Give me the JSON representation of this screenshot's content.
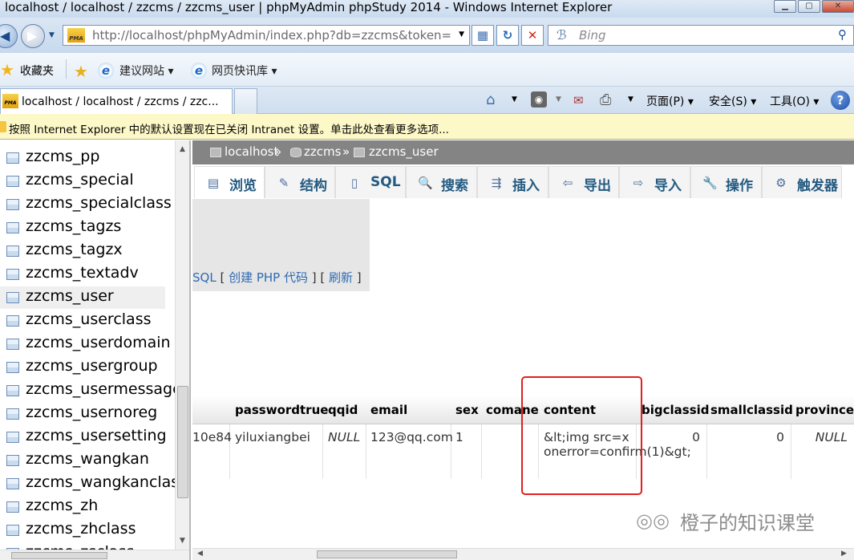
{
  "window": {
    "title": "localhost / localhost / zzcms / zzcms_user | phpMyAdmin phpStudy 2014 - Windows Internet Explorer"
  },
  "address_bar": {
    "url": "http://localhost/phpMyAdmin/index.php?db=zzcms&token=",
    "search_placeholder": "Bing"
  },
  "favorites_bar": {
    "favorites_label": "收藏夹",
    "items": [
      {
        "label": "建议网站 ▾"
      },
      {
        "label": "网页快讯库 ▾"
      }
    ]
  },
  "tabs": [
    {
      "label": "localhost / localhost / zzcms / zzc..."
    }
  ],
  "command_bar": {
    "page_menu": "页面(P) ▾",
    "safety_menu": "安全(S) ▾",
    "tools_menu": "工具(O) ▾"
  },
  "info_bar": {
    "text": "按照 Internet Explorer 中的默认设置现在已关闭 Intranet 设置。单击此处查看更多选项..."
  },
  "left_nav": {
    "tables": [
      {
        "name": "zzcms_pp"
      },
      {
        "name": "zzcms_special"
      },
      {
        "name": "zzcms_specialclass"
      },
      {
        "name": "zzcms_tagzs"
      },
      {
        "name": "zzcms_tagzx"
      },
      {
        "name": "zzcms_textadv"
      },
      {
        "name": "zzcms_user",
        "selected": true
      },
      {
        "name": "zzcms_userclass"
      },
      {
        "name": "zzcms_userdomain"
      },
      {
        "name": "zzcms_usergroup"
      },
      {
        "name": "zzcms_usermessage"
      },
      {
        "name": "zzcms_usernoreg"
      },
      {
        "name": "zzcms_usersetting"
      },
      {
        "name": "zzcms_wangkan"
      },
      {
        "name": "zzcms_wangkanclass"
      },
      {
        "name": "zzcms_zh"
      },
      {
        "name": "zzcms_zhclass"
      },
      {
        "name": "zzcms_zsclass"
      }
    ]
  },
  "breadcrumb": {
    "server": "localhost",
    "sep": "»",
    "database": "zzcms",
    "table": "zzcms_user"
  },
  "pma_tabs": [
    {
      "label": "浏览",
      "icon": "browse-icon",
      "glyph": "▤"
    },
    {
      "label": "结构",
      "icon": "structure-icon",
      "glyph": "✎"
    },
    {
      "label": "SQL",
      "icon": "sql-icon",
      "glyph": "▯"
    },
    {
      "label": "搜索",
      "icon": "search-icon",
      "glyph": "🔍"
    },
    {
      "label": "插入",
      "icon": "insert-icon",
      "glyph": "⇶"
    },
    {
      "label": "导出",
      "icon": "export-icon",
      "glyph": "⇦"
    },
    {
      "label": "导入",
      "icon": "import-icon",
      "glyph": "⇨"
    },
    {
      "label": "操作",
      "icon": "operations-icon",
      "glyph": "🔧"
    },
    {
      "label": "触发器",
      "icon": "triggers-icon",
      "glyph": "⚙"
    }
  ],
  "query_links": {
    "sql": "SQL",
    "php_code": "创建 PHP 代码",
    "refresh": "刷新"
  },
  "result_table": {
    "columns": [
      "passwordtrue",
      "qqid",
      "email",
      "sex",
      "comane",
      "content",
      "bigclassid",
      "smallclassid",
      "province"
    ],
    "row": {
      "partial_prev": "10e84",
      "passwordtrue": "yiluxiangbei",
      "qqid": "NULL",
      "email": "123@qq.com",
      "sex": "1",
      "comane": "",
      "content": "&lt;img src=x onerror=confirm(1)&gt;",
      "bigclassid": "0",
      "smallclassid": "0",
      "province": "NULL"
    }
  },
  "watermark": {
    "text": "橙子的知识课堂"
  },
  "colors": {
    "breadcrumb_bg": "#848484",
    "tab_label": "#235a81",
    "link": "#2d6bb2",
    "highlight": "#e02020",
    "infobar_bg": "#fdf8c8"
  }
}
